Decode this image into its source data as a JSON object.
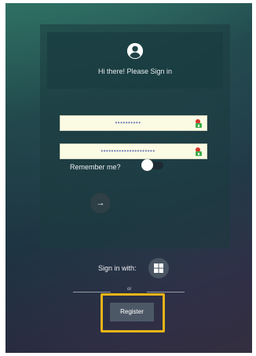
{
  "login": {
    "greeting": "Hi there! Please Sign in",
    "username_value": "••••••••••",
    "password_value": "•••••••••••••••••••••",
    "remember_label": "Remember me?",
    "remember_checked": false,
    "submit_icon": "arrow-right-icon",
    "submit_glyph": "→"
  },
  "alternatives": {
    "signin_with_label": "Sign in with:",
    "provider_icon": "windows-icon",
    "or_label": "or",
    "register_label": "Register"
  },
  "colors": {
    "highlight": "#e9b418",
    "field_background": "#fbfbe4"
  }
}
